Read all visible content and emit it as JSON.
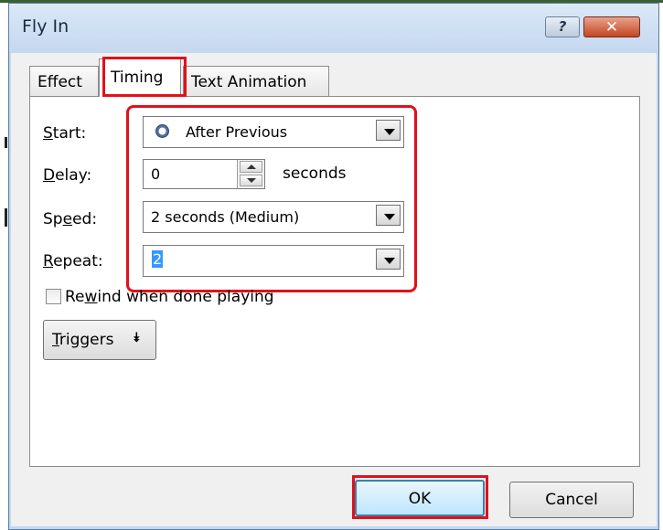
{
  "window": {
    "title": "Fly In",
    "help_glyph": "?",
    "close_glyph": "✕"
  },
  "tabs": [
    {
      "label": "Effect",
      "selected": false
    },
    {
      "label": "Timing",
      "selected": true
    },
    {
      "label": "Text Animation",
      "selected": false
    }
  ],
  "timing": {
    "start": {
      "label_pre": "",
      "label_u": "S",
      "label_post": "tart:",
      "value": "After Previous",
      "icon": "clock-icon"
    },
    "delay": {
      "label_pre": "",
      "label_u": "D",
      "label_post": "elay:",
      "value": "0",
      "unit": "seconds"
    },
    "speed": {
      "label_pre": "Sp",
      "label_u": "e",
      "label_post": "ed:",
      "value": "2 seconds (Medium)"
    },
    "repeat": {
      "label_pre": "",
      "label_u": "R",
      "label_post": "epeat:",
      "value": "2"
    },
    "rewind": {
      "label_pre": "Re",
      "label_u": "w",
      "label_post": "ind when done playing",
      "checked": false
    },
    "triggers": {
      "label_pre": "",
      "label_u": "T",
      "label_post": "riggers",
      "arrow": "⯯"
    }
  },
  "buttons": {
    "ok": "OK",
    "cancel": "Cancel"
  },
  "colors": {
    "highlight": "#e0111b",
    "selection": "#3399ff"
  }
}
